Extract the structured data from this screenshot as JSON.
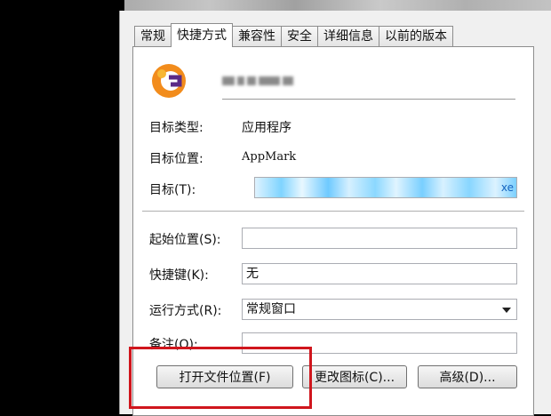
{
  "tabs": [
    "常规",
    "快捷方式",
    "兼容性",
    "安全",
    "详细信息",
    "以前的版本"
  ],
  "active_tab": "快捷方式",
  "fields": {
    "target_type": {
      "label": "目标类型:",
      "value": "应用程序"
    },
    "target_location": {
      "label": "目标位置:",
      "value": "AppMark"
    },
    "target": {
      "label": "目标(T):",
      "value": "xe"
    },
    "start_in": {
      "label": "起始位置(S):",
      "value": ""
    },
    "shortcut_key": {
      "label": "快捷键(K):",
      "value": "无"
    },
    "run": {
      "label": "运行方式(R):",
      "value": "常规窗口"
    },
    "comment": {
      "label": "备注(O):",
      "value": ""
    }
  },
  "buttons": {
    "open_file_location": "打开文件位置(F)",
    "change_icon": "更改图标(C)...",
    "advanced": "高级(D)..."
  },
  "colors": {
    "highlight": "#d0161d",
    "icon_orange": "#f28c1c",
    "icon_purple": "#5b2a86"
  }
}
